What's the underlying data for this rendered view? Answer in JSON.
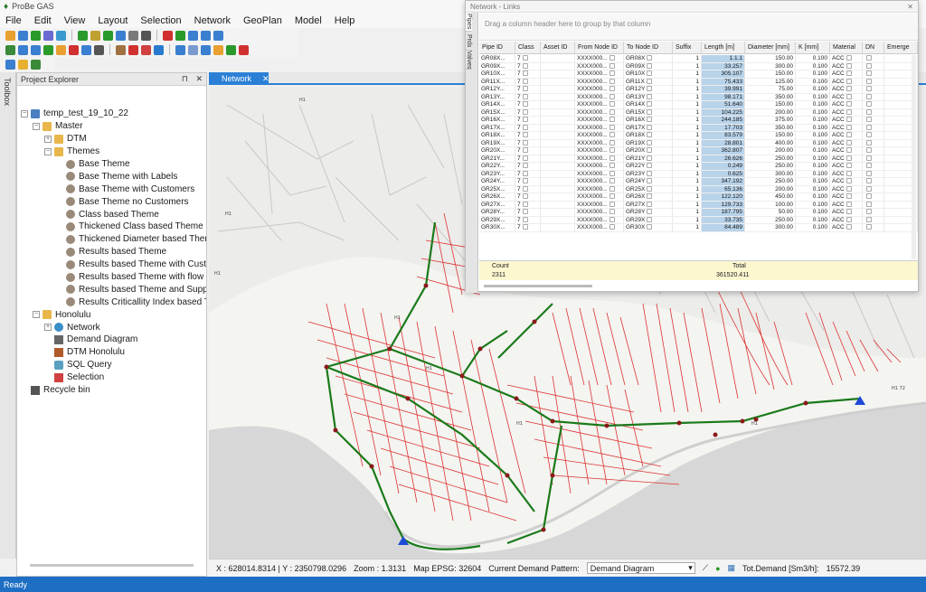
{
  "app": {
    "title": "ProBe GAS"
  },
  "menu": [
    "File",
    "Edit",
    "View",
    "Layout",
    "Selection",
    "Network",
    "GeoPlan",
    "Model",
    "Help"
  ],
  "side_tab": "Toolbox",
  "explorer": {
    "title": "Project Explorer",
    "pin_glyph": "⊓",
    "close_glyph": "✕",
    "tree": [
      {
        "label": "temp_test_19_10_22",
        "level": 0,
        "icon": "project-icon",
        "exp": "−"
      },
      {
        "label": "Master",
        "level": 1,
        "icon": "folder-icon",
        "exp": "−"
      },
      {
        "label": "DTM",
        "level": 2,
        "icon": "folder-icon",
        "exp": "+"
      },
      {
        "label": "Themes",
        "level": 2,
        "icon": "folder-icon",
        "exp": "−"
      },
      {
        "label": "Base Theme",
        "level": 3,
        "icon": "theme-icon"
      },
      {
        "label": "Base Theme with Labels",
        "level": 3,
        "icon": "theme-icon"
      },
      {
        "label": "Base Theme with Customers",
        "level": 3,
        "icon": "theme-icon"
      },
      {
        "label": "Base Theme no Customers",
        "level": 3,
        "icon": "theme-icon"
      },
      {
        "label": "Class based Theme",
        "level": 3,
        "icon": "theme-icon"
      },
      {
        "label": "Thickened Class based Theme",
        "level": 3,
        "icon": "theme-icon"
      },
      {
        "label": "Thickened Diameter based Theme",
        "level": 3,
        "icon": "theme-icon"
      },
      {
        "label": "Results based Theme",
        "level": 3,
        "icon": "theme-icon"
      },
      {
        "label": "Results based Theme with Customers",
        "level": 3,
        "icon": "theme-icon"
      },
      {
        "label": "Results based Theme with flow direction",
        "level": 3,
        "icon": "theme-icon"
      },
      {
        "label": "Results based Theme and Suppressed",
        "level": 3,
        "icon": "theme-icon"
      },
      {
        "label": "Results Criticallity Index based Theme",
        "level": 3,
        "icon": "theme-icon"
      },
      {
        "label": "Honolulu",
        "level": 1,
        "icon": "folder-icon",
        "exp": "−"
      },
      {
        "label": "Network",
        "level": 2,
        "icon": "network-icon",
        "exp": "+"
      },
      {
        "label": "Demand Diagram",
        "level": 2,
        "icon": "demand-icon"
      },
      {
        "label": "DTM Honolulu",
        "level": 2,
        "icon": "dtm-icon"
      },
      {
        "label": "SQL Query",
        "level": 2,
        "icon": "sql-icon"
      },
      {
        "label": "Selection",
        "level": 2,
        "icon": "selection-icon"
      },
      {
        "label": "Recycle bin",
        "level": 0,
        "icon": "recycle-icon"
      }
    ]
  },
  "map_tab": {
    "label": "Network",
    "close": "✕"
  },
  "links_panel": {
    "title": "Network - Links",
    "vtabs": [
      "Pipes",
      "Prds",
      "Valves"
    ],
    "group_hint": "Drag a column header here to group by that column",
    "columns": [
      "Pipe ID",
      "Class",
      "Asset ID",
      "From Node ID",
      "To Node ID",
      "Suffix",
      "Length [m]",
      "Diameter [mm]",
      "K [mm]",
      "Material",
      "DN",
      "Emerge"
    ],
    "from_node": "XXXX000...",
    "class_value": "7",
    "suffix_value": "1",
    "k_value": "0.100",
    "material_value": "ACC",
    "rows": [
      [
        "GR08X...",
        "GR08X",
        "1.1.1",
        "150.00"
      ],
      [
        "GR09X...",
        "GR09X",
        "33.257",
        "300.00"
      ],
      [
        "GR10X...",
        "GR10X",
        "305.107",
        "150.00"
      ],
      [
        "GR11X...",
        "GR11X",
        "75.433",
        "125.00"
      ],
      [
        "GR12Y...",
        "GR12Y",
        "39.991",
        "75.00"
      ],
      [
        "GR13Y...",
        "GR13Y",
        "98.171",
        "350.00"
      ],
      [
        "GR14X...",
        "GR14X",
        "51.640",
        "150.00"
      ],
      [
        "GR15X...",
        "GR15X",
        "104.225",
        "200.00"
      ],
      [
        "GR16X...",
        "GR16X",
        "244.185",
        "375.00"
      ],
      [
        "GR17X...",
        "GR17X",
        "17.703",
        "350.00"
      ],
      [
        "GR18X...",
        "GR18X",
        "83.579",
        "150.00"
      ],
      [
        "GR19X...",
        "GR19X",
        "28.801",
        "400.00"
      ],
      [
        "GR20X...",
        "GR20X",
        "362.807",
        "200.00"
      ],
      [
        "GR21Y...",
        "GR21Y",
        "26.626",
        "250.00"
      ],
      [
        "GR22Y...",
        "GR22Y",
        "0.249",
        "250.00"
      ],
      [
        "GR23Y...",
        "GR23Y",
        "0.625",
        "300.00"
      ],
      [
        "GR24Y...",
        "GR24Y",
        "347.192",
        "250.00"
      ],
      [
        "GR25X...",
        "GR25X",
        "65.136",
        "200.00"
      ],
      [
        "GR26X...",
        "GR26X",
        "122.120",
        "450.00"
      ],
      [
        "GR27X...",
        "GR27X",
        "129.733",
        "100.00"
      ],
      [
        "GR28Y...",
        "GR28Y",
        "187.795",
        "50.00"
      ],
      [
        "GR29X...",
        "GR29X",
        "33.735",
        "250.00"
      ],
      [
        "GR30X...",
        "GR30X",
        "84.489",
        "300.00"
      ]
    ],
    "footer": {
      "count_label": "Count",
      "count_value": "2311",
      "total_label": "Total",
      "total_value": "361520.411"
    }
  },
  "map_labels": [
    "H1",
    "H1",
    "H1",
    "H1",
    "H1",
    "H1",
    "H1",
    "H1 72"
  ],
  "status": {
    "coords": "X : 628014.8314 | Y : 2350798.0296",
    "zoom": "Zoom : 1.3131",
    "epsg": "Map EPSG: 32604",
    "pattern_label": "Current Demand Pattern:",
    "pattern_value": "Demand Diagram",
    "tot_demand": "Tot.Demand [Sm3/h]:",
    "tot_value": "15572.39",
    "ready": "Ready"
  }
}
